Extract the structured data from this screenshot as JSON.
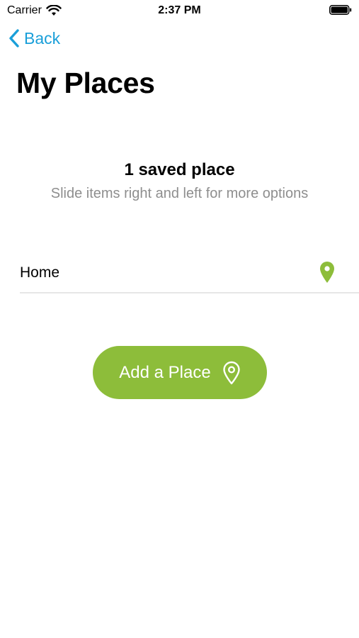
{
  "status_bar": {
    "carrier": "Carrier",
    "time": "2:37 PM",
    "icons": [
      "wifi-icon",
      "battery-icon"
    ]
  },
  "nav": {
    "back_label": "Back",
    "back_icon": "chevron-left-icon"
  },
  "page": {
    "title": "My Places"
  },
  "summary": {
    "count_text": "1 saved place",
    "hint": "Slide items right and left for more options"
  },
  "places": [
    {
      "label": "Home",
      "icon": "location-pin-icon"
    }
  ],
  "actions": {
    "add_place_label": "Add a Place",
    "add_place_icon": "location-pin-outline-icon"
  },
  "colors": {
    "accent_blue": "#1a9fd9",
    "brand_green": "#8dbd3a",
    "hint_gray": "#8e8e8e",
    "divider": "#e6e6e6"
  }
}
